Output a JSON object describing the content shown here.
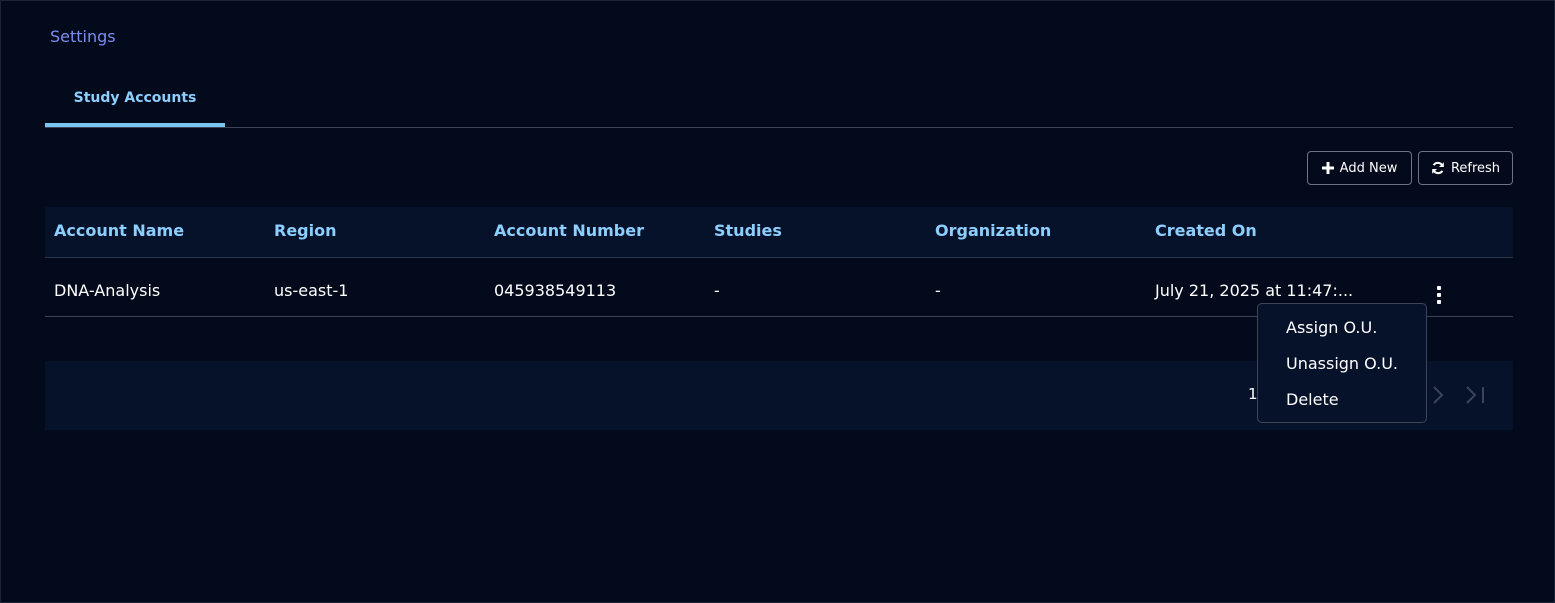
{
  "breadcrumb": "Settings",
  "tabs": [
    {
      "label": "Study Accounts",
      "active": true
    }
  ],
  "toolbar": {
    "add_label": "Add New",
    "refresh_label": "Refresh"
  },
  "table": {
    "headers": [
      "Account Name",
      "Region",
      "Account Number",
      "Studies",
      "Organization",
      "Created On"
    ],
    "rows": [
      {
        "account_name": "DNA-Analysis",
        "region": "us-east-1",
        "account_number": "045938549113",
        "studies": "-",
        "organization": "-",
        "created_on": "July 21, 2025 at 11:47:..."
      }
    ]
  },
  "pagination": {
    "page": "1"
  },
  "row_menu": {
    "items": [
      "Assign O.U.",
      "Unassign O.U.",
      "Delete"
    ]
  },
  "colors": {
    "background": "#030a1c",
    "header_text": "#8ccfff",
    "breadcrumb": "#7b8df2",
    "tab_indicator": "#79c7f0"
  }
}
